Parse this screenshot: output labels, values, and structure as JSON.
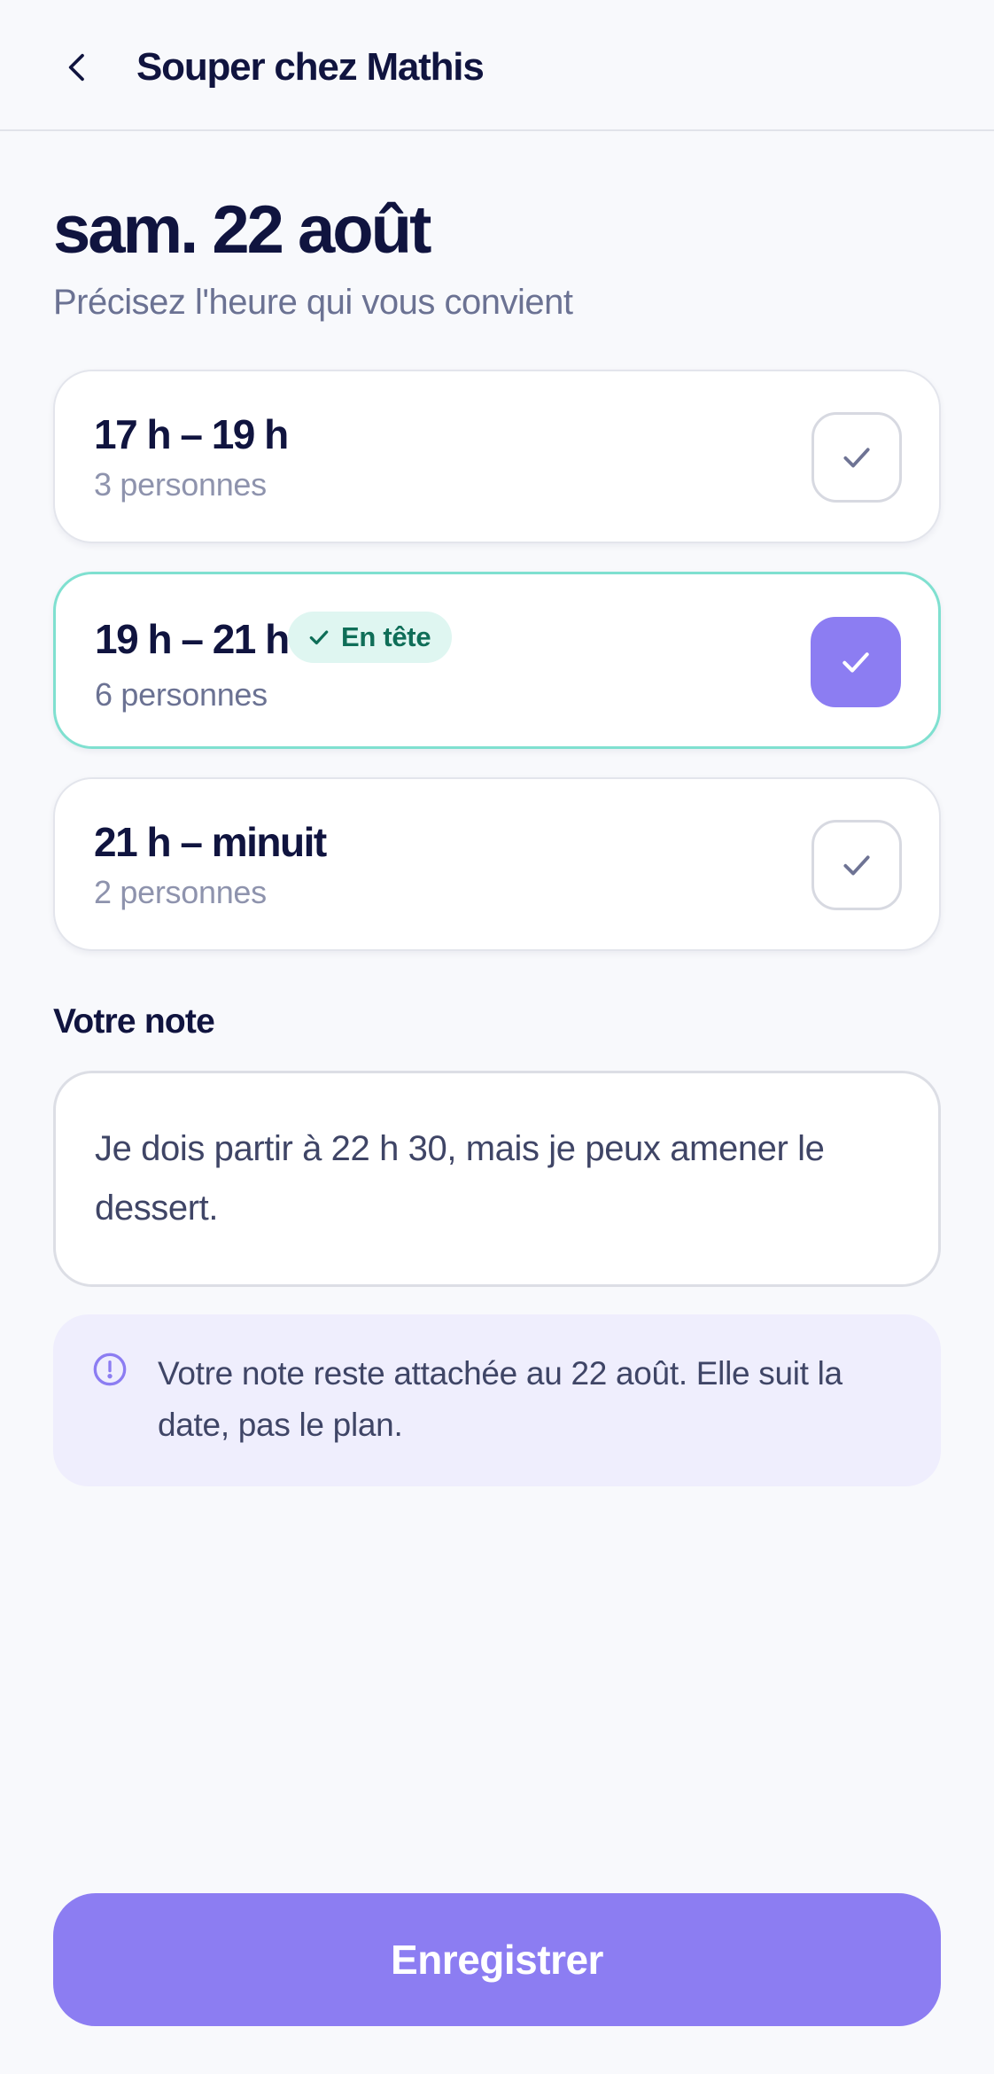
{
  "header": {
    "title": "Souper chez Mathis",
    "back_icon": "chevron-left-icon"
  },
  "date": {
    "title": "sam. 22 août",
    "subtitle": "Précisez l'heure qui vous convient"
  },
  "slots": [
    {
      "time": "17 h – 19 h",
      "count": "3 personnes",
      "selected": false
    },
    {
      "time": "19 h – 21 h",
      "count": "6 personnes",
      "selected": true,
      "badge": "En tête"
    },
    {
      "time": "21 h – minuit",
      "count": "2 personnes",
      "selected": false
    }
  ],
  "note": {
    "label": "Votre note",
    "value": "Je dois partir à 22 h 30, mais je peux amener le dessert."
  },
  "info": {
    "icon": "info-circle-icon",
    "text": "Votre note reste attachée au 22 août. Elle suit la date, pas le plan."
  },
  "save_label": "Enregistrer",
  "colors": {
    "accent": "#8c7df2",
    "selected_border": "#7fe0d0",
    "badge_bg": "#dff6f1",
    "badge_text": "#0f6e58",
    "info_bg": "#efeefd",
    "text_primary": "#10143f"
  }
}
